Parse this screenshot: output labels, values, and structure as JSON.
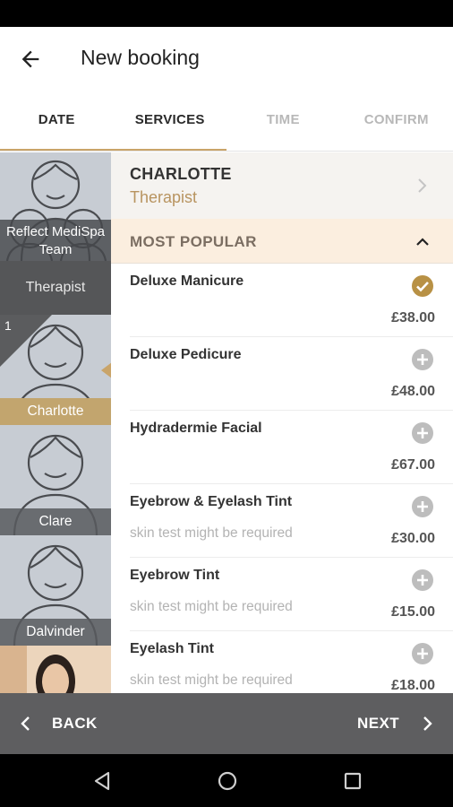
{
  "app_bar": {
    "title": "New booking"
  },
  "tabs": [
    {
      "label": "DATE",
      "state": "active"
    },
    {
      "label": "SERVICES",
      "state": "active"
    },
    {
      "label": "TIME",
      "state": "inactive"
    },
    {
      "label": "CONFIRM",
      "state": "inactive"
    }
  ],
  "staff": {
    "team": {
      "label": "Reflect MediSpa Team"
    },
    "therapist_group": "Therapist",
    "selected_count": "1",
    "members": [
      {
        "name": "Charlotte",
        "selected": true
      },
      {
        "name": "Clare",
        "selected": false
      },
      {
        "name": "Dalvinder",
        "selected": false
      }
    ]
  },
  "therapist": {
    "name": "CHARLOTTE",
    "role": "Therapist"
  },
  "section": {
    "title": "MOST POPULAR"
  },
  "services": [
    {
      "name": "Deluxe Manicure",
      "note": "",
      "price": "£38.00",
      "selected": true
    },
    {
      "name": "Deluxe Pedicure",
      "note": "",
      "price": "£48.00",
      "selected": false
    },
    {
      "name": "Hydradermie Facial",
      "note": "",
      "price": "£67.00",
      "selected": false
    },
    {
      "name": "Eyebrow & Eyelash Tint",
      "note": "skin test might be required",
      "price": "£30.00",
      "selected": false
    },
    {
      "name": "Eyebrow Tint",
      "note": "skin test might be required",
      "price": "£15.00",
      "selected": false
    },
    {
      "name": "Eyelash Tint",
      "note": "skin test might be required",
      "price": "£18.00",
      "selected": false
    }
  ],
  "bottom_bar": {
    "back_label": "BACK",
    "next_label": "NEXT"
  },
  "colors": {
    "accent": "#c9a469",
    "selected_check": "#b89145",
    "add_icon": "#bdbdbd",
    "bottom_bar": "#5e5e60"
  }
}
